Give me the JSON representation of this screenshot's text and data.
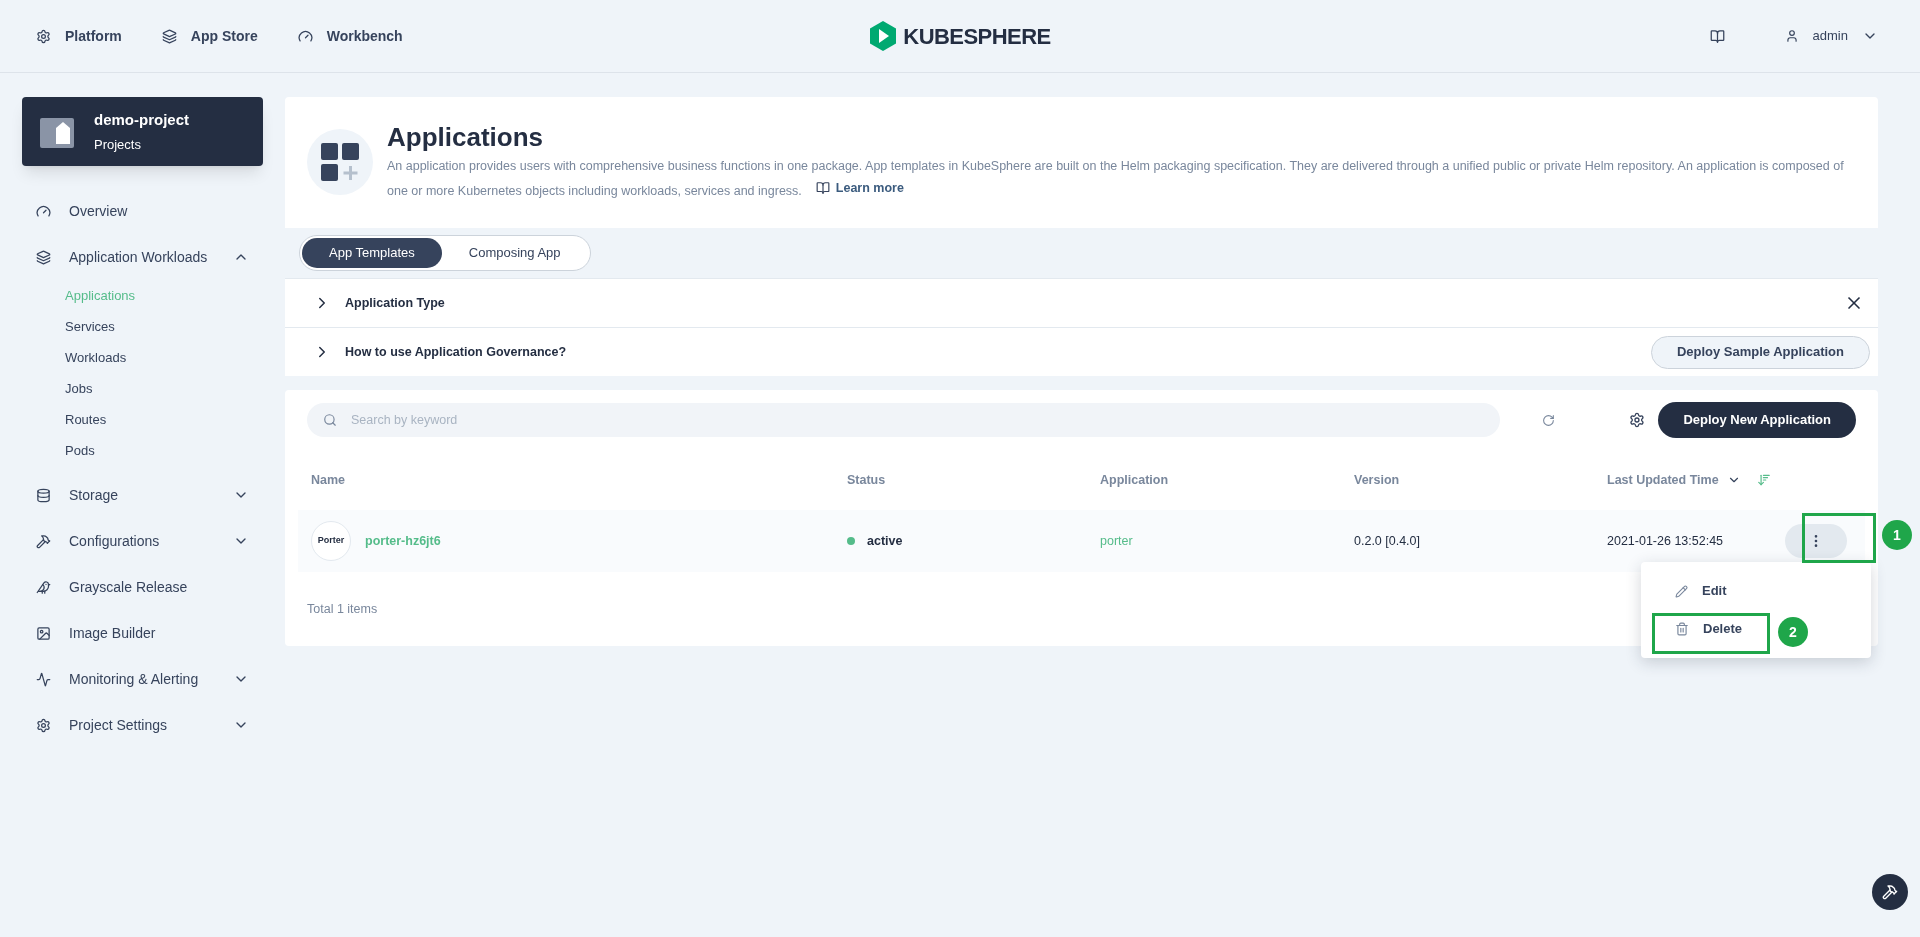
{
  "top_nav": [
    {
      "kind": "gear",
      "label": "Platform"
    },
    {
      "kind": "layers",
      "label": "App Store"
    },
    {
      "kind": "gauge",
      "label": "Workbench"
    }
  ],
  "logo": {
    "text": "KUBESPHERE"
  },
  "user": {
    "name": "admin"
  },
  "project": {
    "name": "demo-project",
    "type": "Projects"
  },
  "sidebar": {
    "items": [
      {
        "kind": "gauge",
        "label": "Overview"
      },
      {
        "kind": "layers",
        "label": "Application Workloads",
        "expanded": true,
        "children": [
          {
            "label": "Applications",
            "selected": true
          },
          {
            "label": "Services",
            "selected": false
          },
          {
            "label": "Workloads",
            "selected": false
          },
          {
            "label": "Jobs",
            "selected": false
          },
          {
            "label": "Routes",
            "selected": false
          },
          {
            "label": "Pods",
            "selected": false
          }
        ]
      },
      {
        "kind": "database",
        "label": "Storage",
        "expanded": false
      },
      {
        "kind": "hammer",
        "label": "Configurations",
        "expanded": false
      },
      {
        "kind": "bird",
        "label": "Grayscale Release"
      },
      {
        "kind": "image",
        "label": "Image Builder"
      },
      {
        "kind": "monitor",
        "label": "Monitoring & Alerting",
        "expanded": false
      },
      {
        "kind": "gear",
        "label": "Project Settings",
        "expanded": false
      }
    ]
  },
  "header": {
    "title": "Applications",
    "description": "An application provides users with comprehensive business functions in one package. App templates in KubeSphere are built on the Helm packaging specification. They are delivered through a unified public or private Helm repository. An application is composed of one or more Kubernetes objects including workloads, services and ingress.",
    "link": "Learn more"
  },
  "tabs": [
    {
      "label": "App Templates",
      "selected": true
    },
    {
      "label": "Composing App",
      "selected": false
    }
  ],
  "info_rows": [
    {
      "label": "Application Type",
      "closable": true
    },
    {
      "label": "How to use Application Governance?",
      "closable": false,
      "action": "Deploy Sample Application"
    }
  ],
  "search": {
    "placeholder": "Search by keyword"
  },
  "primary_button": "Deploy New Application",
  "table": {
    "columns": [
      "Name",
      "Status",
      "Application",
      "Version",
      "Last Updated Time"
    ],
    "rows": [
      {
        "logo_text": "Porter",
        "name": "porter-hz6jt6",
        "status": "active",
        "color": "#55bc8a",
        "application": "porter",
        "version": "0.2.0 [0.4.0]",
        "updated": "2021-01-26 13:52:45"
      }
    ],
    "total": "Total 1 items"
  },
  "row_menu": [
    {
      "kind": "edit",
      "label": "Edit"
    },
    {
      "kind": "delete",
      "label": "Delete"
    }
  ],
  "callouts": [
    {
      "label": "1"
    },
    {
      "label": "2"
    }
  ]
}
